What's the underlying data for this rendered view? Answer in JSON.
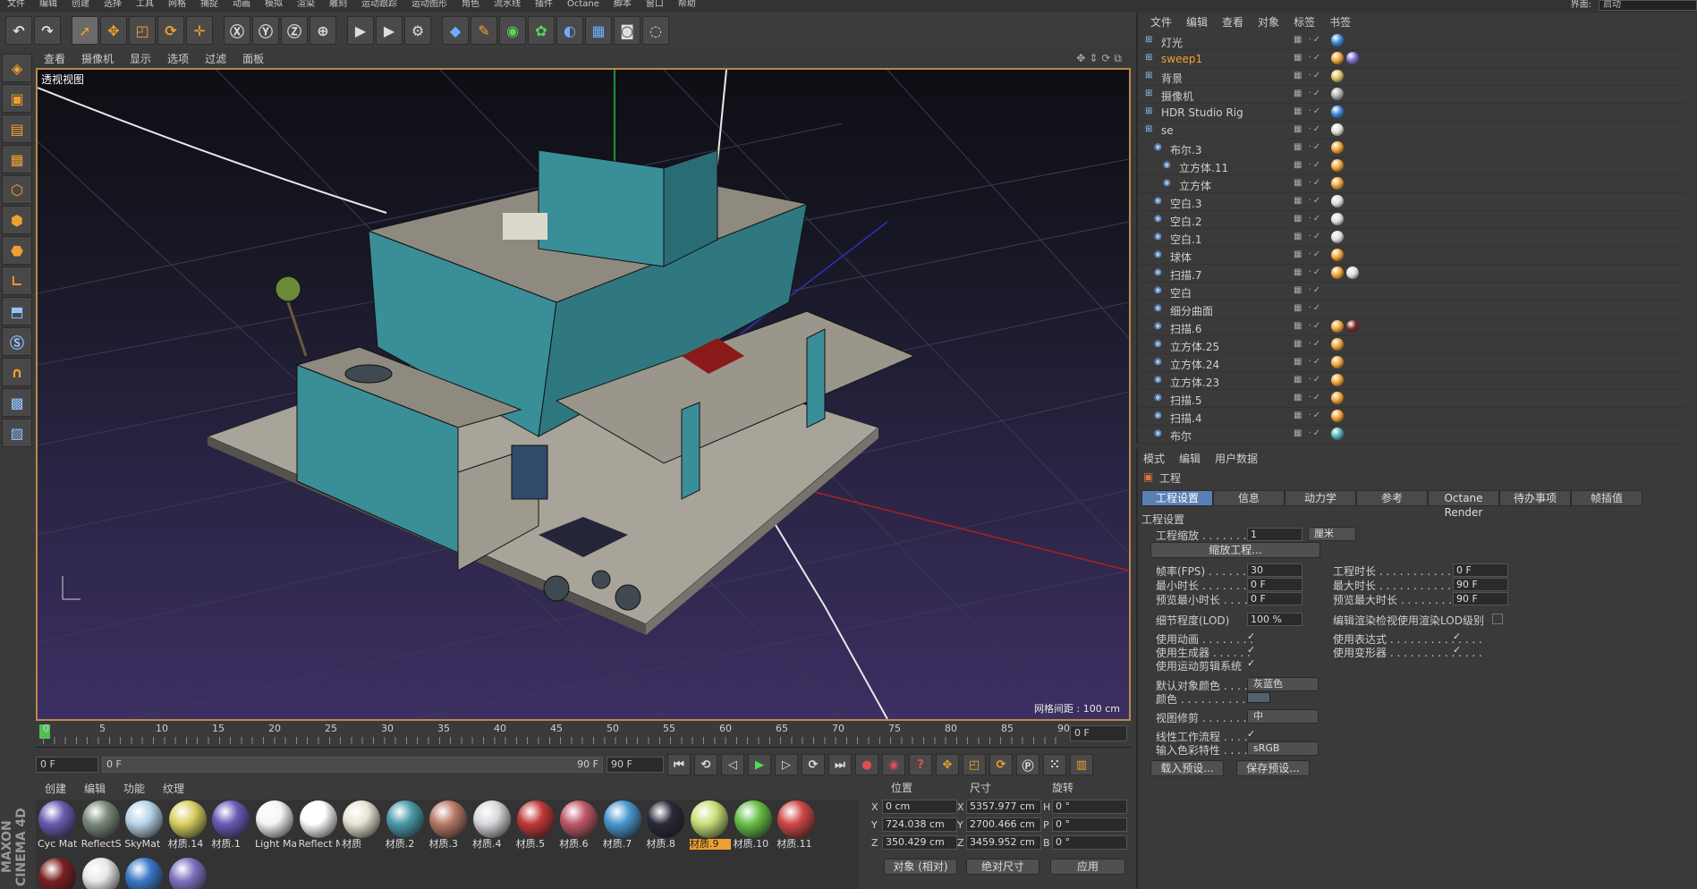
{
  "menubar": {
    "items": [
      "文件",
      "编辑",
      "创建",
      "选择",
      "工具",
      "网格",
      "捕捉",
      "动画",
      "模拟",
      "渲染",
      "雕刻",
      "运动跟踪",
      "运动图形",
      "角色",
      "流水线",
      "插件",
      "Octane",
      "脚本",
      "窗口",
      "帮助"
    ],
    "layout_label": "界面:",
    "layout_value": "启动"
  },
  "viewport_menu": [
    "查看",
    "摄像机",
    "显示",
    "选项",
    "过滤",
    "面板"
  ],
  "viewport": {
    "title": "透视视图",
    "grid_spacing": "网格间距 : 100 cm"
  },
  "timeline": {
    "ticks": [
      "0",
      "5",
      "10",
      "15",
      "20",
      "25",
      "30",
      "35",
      "40",
      "45",
      "50",
      "55",
      "60",
      "65",
      "70",
      "75",
      "80",
      "85",
      "90"
    ],
    "current_frame": "0 F"
  },
  "playbar": {
    "start": "0 F",
    "range_start": "0 F",
    "range_end": "90 F",
    "end": "90 F"
  },
  "material_menu": [
    "创建",
    "编辑",
    "功能",
    "纹理"
  ],
  "materials": [
    {
      "label": "Cyc Mat",
      "color": "#6a5bb0"
    },
    {
      "label": "ReflectS",
      "color": "#7a8a7a"
    },
    {
      "label": "SkyMat",
      "color": "#b8d4e8"
    },
    {
      "label": "材质.14",
      "color": "#d8d060"
    },
    {
      "label": "材质.1",
      "color": "#6a5ab8"
    },
    {
      "label": "Light Ma",
      "color": "#f4f4f4"
    },
    {
      "label": "Reflect M",
      "color": "#ffffff"
    },
    {
      "label": "材质",
      "color": "#e8e4d4"
    },
    {
      "label": "材质.2",
      "color": "#4a9aa8"
    },
    {
      "label": "材质.3",
      "color": "#b87a68"
    },
    {
      "label": "材质.4",
      "color": "#d8d8dc"
    },
    {
      "label": "材质.5",
      "color": "#c03838"
    },
    {
      "label": "材质.6",
      "color": "#c05868"
    },
    {
      "label": "材质.7",
      "color": "#4a98d0"
    },
    {
      "label": "材质.8",
      "color": "#2a2a38"
    },
    {
      "label": "材质.9",
      "color": "#c8e078"
    },
    {
      "label": "材质.10",
      "color": "#68c048"
    },
    {
      "label": "材质.11",
      "color": "#d04848"
    }
  ],
  "materials_row2": [
    {
      "color": "#7a2020"
    },
    {
      "color": "#e8e8e8"
    },
    {
      "color": "#3a78c8"
    },
    {
      "color": "#8070c0"
    }
  ],
  "coords": {
    "headers": [
      "位置",
      "尺寸",
      "旋转"
    ],
    "rows": [
      {
        "axis": "X",
        "pos": "0 cm",
        "size_axis": "X",
        "size": "5357.977 cm",
        "rot_axis": "H",
        "rot": "0 °"
      },
      {
        "axis": "Y",
        "pos": "724.038 cm",
        "size_axis": "Y",
        "size": "2700.466 cm",
        "rot_axis": "P",
        "rot": "0 °"
      },
      {
        "axis": "Z",
        "pos": "350.429 cm",
        "size_axis": "Z",
        "size": "3459.952 cm",
        "rot_axis": "B",
        "rot": "0 °"
      }
    ],
    "mode": "对象 (相对)",
    "size_mode": "绝对尺寸",
    "apply": "应用"
  },
  "object_manager": {
    "menu": [
      "文件",
      "编辑",
      "查看",
      "对象",
      "标签",
      "书签"
    ],
    "rows": [
      {
        "name": "灯光",
        "indent": 0,
        "color": "#cfcfcf",
        "tags": [
          "#3a8ae0"
        ]
      },
      {
        "name": "sweep1",
        "indent": 0,
        "color": "#f0a030",
        "tags": [
          "#f0a030",
          "#7a6ad0"
        ]
      },
      {
        "name": "背景",
        "indent": 0,
        "color": "#cfcfcf",
        "tags": [
          "#d8c060"
        ]
      },
      {
        "name": "摄像机",
        "indent": 0,
        "color": "#cfcfcf",
        "tags": [
          "#aaaaaa"
        ]
      },
      {
        "name": "HDR Studio Rig",
        "indent": 0,
        "color": "#cfcfcf",
        "tags": [
          "#3a8ae0"
        ]
      },
      {
        "name": "se",
        "indent": 0,
        "color": "#cfcfcf",
        "tags": [
          "#e0e0d0"
        ]
      },
      {
        "name": "布尔.3",
        "indent": 1,
        "color": "#cfcfcf",
        "tags": [
          "#f0a030"
        ]
      },
      {
        "name": "立方体.11",
        "indent": 2,
        "color": "#cfcfcf",
        "tags": [
          "#f0a030"
        ]
      },
      {
        "name": "立方体",
        "indent": 2,
        "color": "#cfcfcf",
        "tags": [
          "#f0a030"
        ]
      },
      {
        "name": "空白.3",
        "indent": 1,
        "color": "#cfcfcf",
        "tags": [
          "#dcdcdc"
        ]
      },
      {
        "name": "空白.2",
        "indent": 1,
        "color": "#cfcfcf",
        "tags": [
          "#dcdcdc"
        ]
      },
      {
        "name": "空白.1",
        "indent": 1,
        "color": "#cfcfcf",
        "tags": [
          "#dcdcdc"
        ]
      },
      {
        "name": "球体",
        "indent": 1,
        "color": "#cfcfcf",
        "tags": [
          "#f0a030"
        ]
      },
      {
        "name": "扫描.7",
        "indent": 1,
        "color": "#cfcfcf",
        "tags": [
          "#f0a030",
          "#dcdcdc"
        ]
      },
      {
        "name": "空白",
        "indent": 1,
        "color": "#cfcfcf",
        "tags": []
      },
      {
        "name": "细分曲面",
        "indent": 1,
        "color": "#cfcfcf",
        "tags": []
      },
      {
        "name": "扫描.6",
        "indent": 1,
        "color": "#cfcfcf",
        "tags": [
          "#f0a030",
          "#7a2020"
        ]
      },
      {
        "name": "立方体.25",
        "indent": 1,
        "color": "#cfcfcf",
        "tags": [
          "#f0a030"
        ]
      },
      {
        "name": "立方体.24",
        "indent": 1,
        "color": "#cfcfcf",
        "tags": [
          "#f0a030"
        ]
      },
      {
        "name": "立方体.23",
        "indent": 1,
        "color": "#cfcfcf",
        "tags": [
          "#f0a030"
        ]
      },
      {
        "name": "扫描.5",
        "indent": 1,
        "color": "#cfcfcf",
        "tags": [
          "#f0a030"
        ]
      },
      {
        "name": "扫描.4",
        "indent": 1,
        "color": "#cfcfcf",
        "tags": [
          "#f0a030"
        ]
      },
      {
        "name": "布尔",
        "indent": 1,
        "color": "#cfcfcf",
        "tags": [
          "#4ab0b8"
        ]
      }
    ]
  },
  "attributes": {
    "menu": [
      "模式",
      "编辑",
      "用户数据"
    ],
    "title": "工程",
    "tabs": [
      "工程设置",
      "信息",
      "动力学",
      "参考",
      "Octane Render",
      "待办事项",
      "帧插值"
    ],
    "section": "工程设置",
    "project_scale_label": "工程缩放 . . . . . . . .",
    "project_scale_value": "1",
    "project_scale_unit": "厘米",
    "scale_button": "缩放工程...",
    "fps_label": "帧率(FPS) . . . . . . . .",
    "fps_value": "30",
    "min_time_label": "最小时长 . . . . . . . .",
    "min_time_value": "0 F",
    "preview_min_label": "预览最小时长 . . . .",
    "preview_min_value": "0 F",
    "project_time_label": "工程时长 . . . . . . . . . . . . . . . .",
    "project_time_value": "0 F",
    "max_time_label": "最大时长 . . . . . . . . . . . . . . . .",
    "max_time_value": "90 F",
    "preview_max_label": "预览最大时长 . . . . . . . . . . . .",
    "preview_max_value": "90 F",
    "lod_label": "细节程度(LOD)",
    "lod_value": "100 %",
    "lod_render_label": "编辑渲染检视使用渲染LOD级别",
    "use_anim_label": "使用动画 . . . . . . . .",
    "use_gen_label": "使用生成器 . . . . . .",
    "use_motion_label": "使用运动剪辑系统",
    "use_expr_label": "使用表达式 . . . . . . . . . . . . . .",
    "use_deform_label": "使用变形器 . . . . . . . . . . . . . .",
    "default_color_label": "默认对象颜色 . . . .",
    "default_color_value": "灰蓝色",
    "color_label": "颜色 . . . . . . . . . . . .",
    "view_clip_label": "视图修剪 . . . . . . . .",
    "view_clip_value": "中",
    "linear_label": "线性工作流程 . . . .",
    "input_color_label": "输入色彩特性 . . . .",
    "input_color_value": "sRGB",
    "load_preset": "载入预设...",
    "save_preset": "保存预设..."
  }
}
